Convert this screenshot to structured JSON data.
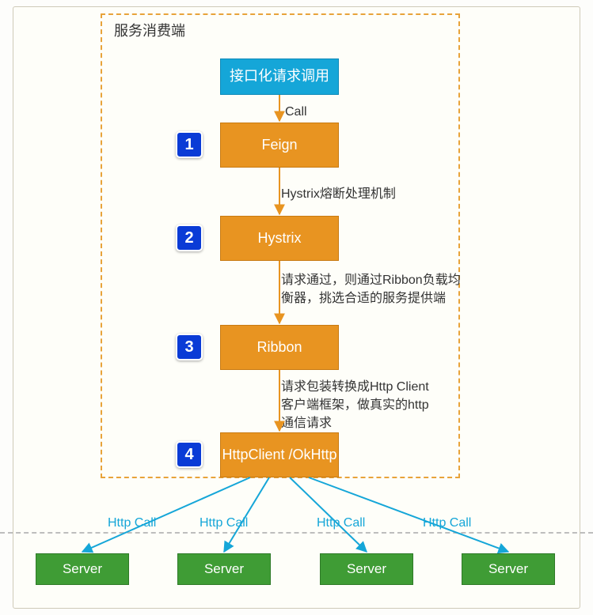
{
  "diagram": {
    "title": "服务消费端",
    "nodes": {
      "entry": "接口化请求调用",
      "feign": "Feign",
      "hystrix": "Hystrix",
      "ribbon": "Ribbon",
      "httpclient": "HttpClient\n/OkHttp"
    },
    "steps": {
      "s1": "1",
      "s2": "2",
      "s3": "3",
      "s4": "4"
    },
    "edges": {
      "call": "Call",
      "hystrix_note": "Hystrix熔断处理机制",
      "ribbon_note": "请求通过，则通过Ribbon负载均\n衡器，挑选合适的服务提供端",
      "http_note": "请求包装转换成Http Client\n客户端框架，做真实的http\n通信请求",
      "http_call": "Http Call"
    },
    "servers": {
      "label": "Server"
    },
    "colors": {
      "blue": "#15a6d8",
      "orange": "#e89421",
      "number": "#0a3bd6",
      "green": "#3f9c35"
    }
  }
}
